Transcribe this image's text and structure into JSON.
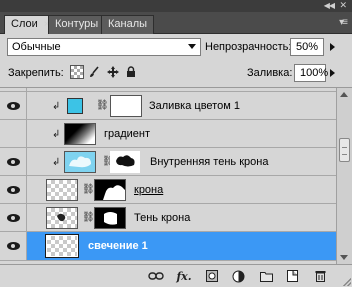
{
  "tabs": [
    {
      "label": "Слои",
      "active": true
    },
    {
      "label": "Контуры",
      "active": false
    },
    {
      "label": "Каналы",
      "active": false
    }
  ],
  "options": {
    "blend_mode": "Обычные",
    "opacity_label": "Непрозрачность:",
    "opacity_value": "50%",
    "lock_label": "Закрепить:",
    "fill_label": "Заливка:",
    "fill_value": "100%"
  },
  "layers": [
    {
      "name": "Заливка цветом 1",
      "visible": true,
      "clipped": true,
      "thumb": "color-fill",
      "mask": "white",
      "selected": false
    },
    {
      "name": "градиент",
      "visible": false,
      "clipped": true,
      "thumb": "gradient",
      "mask": null,
      "selected": false
    },
    {
      "name": "Внутренняя тень крона",
      "visible": true,
      "clipped": true,
      "thumb": "blue-crown",
      "mask": "crown-shape",
      "selected": false
    },
    {
      "name": "крона",
      "visible": true,
      "clipped": false,
      "thumb": "transparent",
      "mask": "crown-mask",
      "selected": false
    },
    {
      "name": "Тень крона",
      "visible": true,
      "clipped": false,
      "thumb": "transparent-shadow",
      "mask": "shadow-mask",
      "selected": false
    },
    {
      "name": "свечение 1",
      "visible": true,
      "clipped": false,
      "thumb": "transparent",
      "mask": null,
      "selected": true
    }
  ],
  "colors": {
    "panel_bg": "#d6d6d6",
    "selection": "#3b98f5",
    "fill_swatch": "#3cc3e6",
    "header_bg": "#4b4b4b"
  }
}
